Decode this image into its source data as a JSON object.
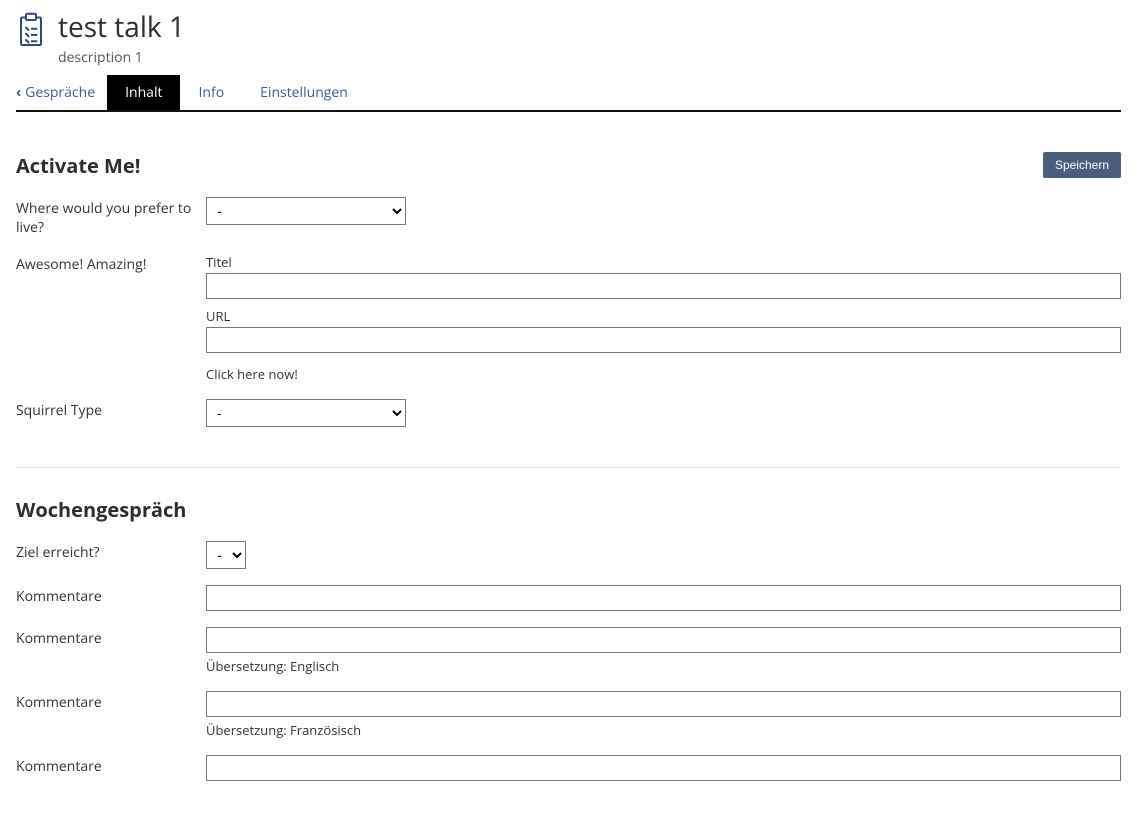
{
  "header": {
    "title": "test talk 1",
    "subtitle": "description 1"
  },
  "tabs": {
    "back": "Gespräche",
    "items": [
      {
        "label": "Inhalt",
        "active": true
      },
      {
        "label": "Info",
        "active": false
      },
      {
        "label": "Einstellungen",
        "active": false
      }
    ]
  },
  "save_button": "Speichern",
  "section1": {
    "title": "Activate Me!",
    "q_live": "Where would you pre­fer to live?",
    "q_live_value": "-",
    "awesome_label": "Awe­some! Amaz­ing!",
    "titel_label": "Titel",
    "titel_value": "",
    "url_label": "URL",
    "url_value": "",
    "click_hint": "Click here now!",
    "squirrel_label": "Squir­rel Type",
    "squirrel_value": "-"
  },
  "section2": {
    "title": "Wochengespräch",
    "goal_label": "Ziel erre­icht?",
    "goal_value": "-",
    "comment1_label": "Kom­mentare",
    "comment1_value": "",
    "comment2_label": "Kom­mentare",
    "comment2_value": "",
    "comment2_hint": "Über­set­zung: Englisch",
    "comment3_label": "Kom­mentare",
    "comment3_value": "",
    "comment3_hint": "Über­set­zung: Franzö­sisch",
    "comment4_label": "Kom­mentare",
    "comment4_value": ""
  }
}
